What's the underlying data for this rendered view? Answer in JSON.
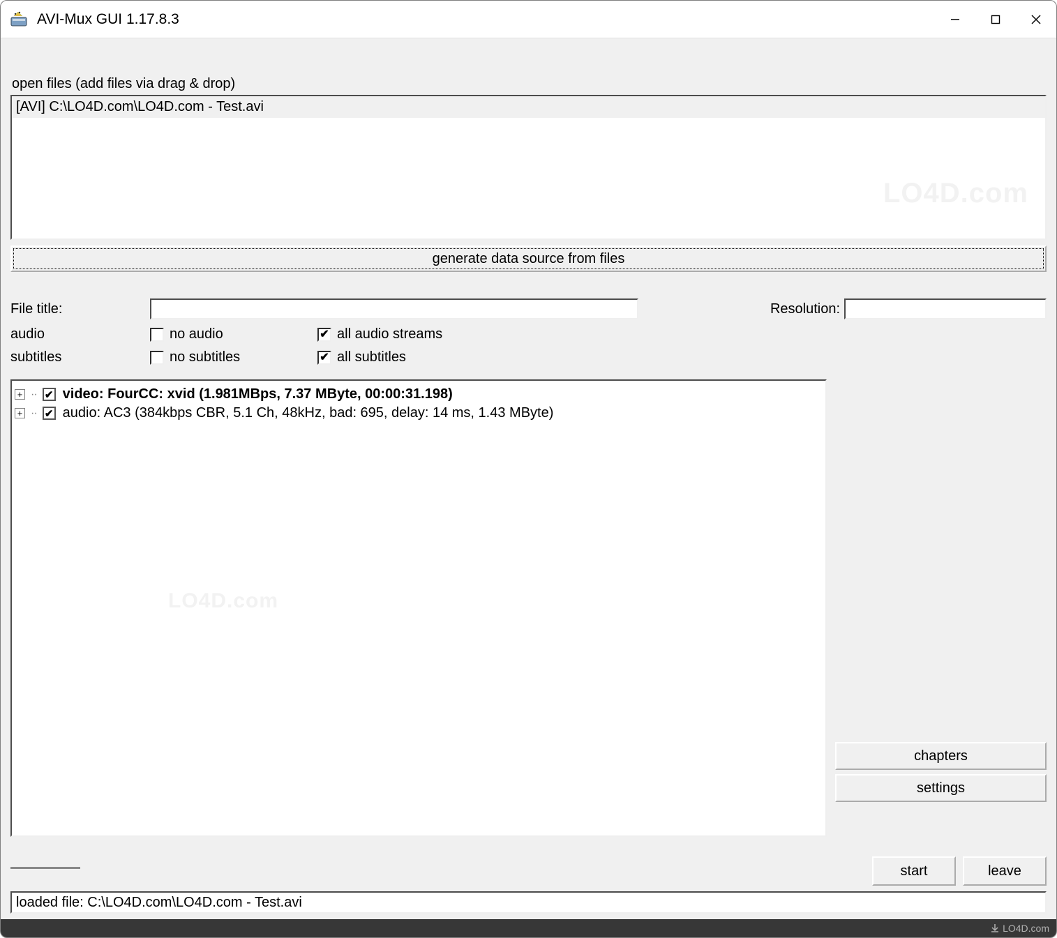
{
  "title": "AVI-Mux GUI 1.17.8.3",
  "sections": {
    "open_files_label": "open files (add files via drag & drop)",
    "file_list": [
      "[AVI] C:\\LO4D.com\\LO4D.com - Test.avi"
    ],
    "generate_btn": "generate data source from files"
  },
  "options": {
    "file_title_label": "File title:",
    "file_title_value": "",
    "resolution_label": "Resolution:",
    "resolution_value": "",
    "audio_label": "audio",
    "subtitles_label": "subtitles",
    "no_audio": {
      "label": "no audio",
      "checked": false
    },
    "all_audio": {
      "label": "all audio streams",
      "checked": true
    },
    "no_subs": {
      "label": "no subtitles",
      "checked": false
    },
    "all_subs": {
      "label": "all subtitles",
      "checked": true
    }
  },
  "streams": [
    {
      "text": "video: FourCC: xvid (1.981MBps, 7.37 MByte, 00:00:31.198)",
      "bold": true,
      "checked": true
    },
    {
      "text": "audio: AC3 (384kbps CBR, 5.1 Ch, 48kHz, bad: 695, delay: 14 ms, 1.43 MByte)",
      "bold": false,
      "checked": true
    }
  ],
  "buttons": {
    "chapters": "chapters",
    "settings": "settings",
    "start": "start",
    "leave": "leave"
  },
  "status": "loaded file: C:\\LO4D.com\\LO4D.com - Test.avi",
  "watermark": "LO4D.com",
  "footer": "LO4D.com"
}
